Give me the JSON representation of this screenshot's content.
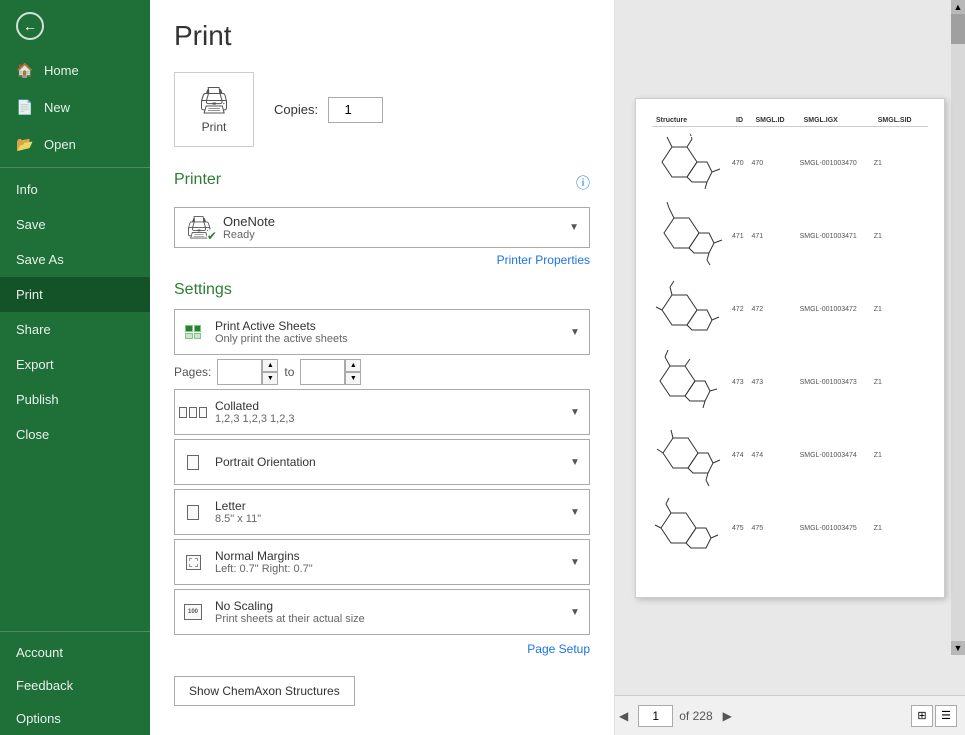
{
  "sidebar": {
    "back_title": "Back",
    "items_top": [
      {
        "id": "home",
        "label": "Home",
        "icon": "🏠"
      },
      {
        "id": "new",
        "label": "New",
        "icon": "📄"
      },
      {
        "id": "open",
        "label": "Open",
        "icon": "📂"
      }
    ],
    "items_middle": [
      {
        "id": "info",
        "label": "Info",
        "icon": ""
      },
      {
        "id": "save",
        "label": "Save",
        "icon": ""
      },
      {
        "id": "save-as",
        "label": "Save As",
        "icon": ""
      },
      {
        "id": "print",
        "label": "Print",
        "icon": "",
        "active": true
      },
      {
        "id": "share",
        "label": "Share",
        "icon": ""
      },
      {
        "id": "export",
        "label": "Export",
        "icon": ""
      },
      {
        "id": "publish",
        "label": "Publish",
        "icon": ""
      },
      {
        "id": "close",
        "label": "Close",
        "icon": ""
      }
    ],
    "items_bottom": [
      {
        "id": "account",
        "label": "Account",
        "icon": ""
      },
      {
        "id": "feedback",
        "label": "Feedback",
        "icon": ""
      },
      {
        "id": "options",
        "label": "Options",
        "icon": ""
      }
    ]
  },
  "print": {
    "title": "Print",
    "copies_label": "Copies:",
    "copies_value": "1",
    "print_button_label": "Print",
    "printer_section_title": "Printer",
    "printer_name": "OneNote",
    "printer_status": "Ready",
    "printer_properties_link": "Printer Properties",
    "settings_section_title": "Settings",
    "active_sheets_label": "Print Active Sheets",
    "active_sheets_sub": "Only print the active sheets",
    "pages_label": "Pages:",
    "pages_from": "",
    "pages_to_label": "to",
    "pages_to": "",
    "collated_label": "Collated",
    "collated_sub": "1,2,3   1,2,3   1,2,3",
    "orientation_label": "Portrait Orientation",
    "paper_label": "Letter",
    "paper_sub": "8.5\" x 11\"",
    "margins_label": "Normal Margins",
    "margins_sub": "Left: 0.7\"   Right: 0.7\"",
    "scaling_label": "No Scaling",
    "scaling_sub": "Print sheets at their actual size",
    "page_setup_link": "Page Setup",
    "chemaxon_button": "Show ChemAxon Structures"
  },
  "preview": {
    "current_page": "1",
    "total_pages": "228",
    "prev_icon": "◀",
    "next_icon": "▶",
    "of_label": "of",
    "columns": [
      {
        "label": "Structure",
        "color": "green"
      },
      {
        "label": "ID",
        "color": "blue"
      },
      {
        "label": "SMGL.ID",
        "color": "orange"
      },
      {
        "label": "SMGL.IGX",
        "color": "orange"
      },
      {
        "label": "SMGL.SID",
        "color": "orange"
      }
    ],
    "rows": [
      {
        "id": "470",
        "smgl_id": "470",
        "smgl_igx": "SMGL-001003470",
        "smgl_sid": "Z1"
      },
      {
        "id": "471",
        "smgl_id": "471",
        "smgl_igx": "SMGL-001003471",
        "smgl_sid": "Z1"
      },
      {
        "id": "472",
        "smgl_id": "472",
        "smgl_igx": "SMGL-001003472",
        "smgl_sid": "Z1"
      },
      {
        "id": "473",
        "smgl_id": "473",
        "smgl_igx": "SMGL-001003473",
        "smgl_sid": "Z1"
      },
      {
        "id": "474",
        "smgl_id": "474",
        "smgl_igx": "SMGL-001003474",
        "smgl_sid": "Z1"
      },
      {
        "id": "475",
        "smgl_id": "475",
        "smgl_igx": "SMGL-001003475",
        "smgl_sid": "Z1"
      }
    ]
  }
}
